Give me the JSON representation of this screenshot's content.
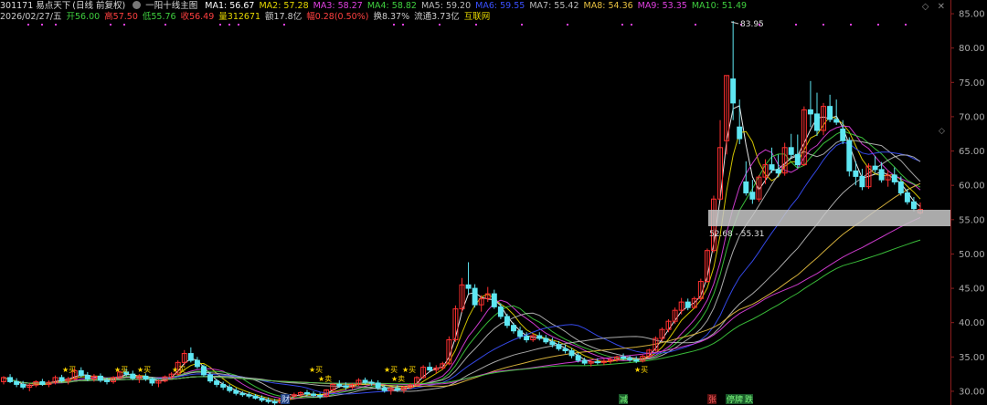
{
  "header": {
    "code": "301171",
    "name": "易点天下",
    "mode": "(日线 前复权)",
    "indicator": "一阳十线主图",
    "ma": [
      {
        "label": "MA1: 56.67",
        "color": "#ffffff"
      },
      {
        "label": "MA2: 57.28",
        "color": "#e5d700"
      },
      {
        "label": "MA3: 58.27",
        "color": "#e040e0"
      },
      {
        "label": "MA4: 58.82",
        "color": "#3fcf3f"
      },
      {
        "label": "MA5: 59.20",
        "color": "#bbbbbb"
      },
      {
        "label": "MA6: 59.55",
        "color": "#3a50ff"
      },
      {
        "label": "MA7: 55.42",
        "color": "#bbbbbb"
      },
      {
        "label": "MA8: 54.36",
        "color": "#e8c040"
      },
      {
        "label": "MA9: 53.35",
        "color": "#e040e0"
      },
      {
        "label": "MA10: 51.49",
        "color": "#3fcf3f"
      }
    ]
  },
  "info": [
    {
      "text": "2026/02/27/五",
      "color": "#cccccc"
    },
    {
      "text": "开56.00",
      "color": "#3fcf3f"
    },
    {
      "text": "高57.50",
      "color": "#ff4040"
    },
    {
      "text": "低55.76",
      "color": "#3fcf3f"
    },
    {
      "text": "收56.49",
      "color": "#ff4040"
    },
    {
      "text": "量312671",
      "color": "#e5d700"
    },
    {
      "text": "额17.8亿",
      "color": "#cccccc"
    },
    {
      "text": "幅0.28(0.50%)",
      "color": "#ff4040"
    },
    {
      "text": "换8.37%",
      "color": "#cccccc"
    },
    {
      "text": "流通3.73亿",
      "color": "#cccccc"
    },
    {
      "text": "互联网",
      "color": "#e5d700"
    }
  ],
  "axis": {
    "min": 28,
    "max": 87,
    "ticks": [
      "85.00",
      "80.00",
      "75.00",
      "70.00",
      "65.00",
      "60.00",
      "55.00",
      "50.00",
      "45.00",
      "40.00",
      "35.00",
      "30.00"
    ]
  },
  "annotations": {
    "high": "83.95",
    "low": "27.52",
    "zone": "52.68 - 55.31"
  },
  "markers": {
    "cai": "财",
    "jian": "减",
    "zhang": "张",
    "tingpai": "停牌",
    "die": "跌",
    "buy": "★买",
    "sell": "★卖"
  },
  "window": {
    "restore_icon": "◇",
    "close_icon": "✕"
  },
  "colors": {
    "up": "#ff3030",
    "down": "#5ee6f2",
    "background": "#000000",
    "axis": "#aaaaaa"
  },
  "chart_data": {
    "type": "candlestick",
    "ylim": [
      28,
      87
    ],
    "candles": [
      [
        31.4,
        32.2,
        31,
        32
      ],
      [
        32,
        32.5,
        31.2,
        31.4
      ],
      [
        31.4,
        31.9,
        30.6,
        31
      ],
      [
        31,
        31.5,
        30.3,
        30.6
      ],
      [
        30.6,
        31.2,
        30,
        30.9
      ],
      [
        30.9,
        31.6,
        30.6,
        31.4
      ],
      [
        31.4,
        31.8,
        30.8,
        31
      ],
      [
        31,
        31.6,
        30.6,
        31.3
      ],
      [
        31.3,
        32.3,
        31,
        32
      ],
      [
        32,
        32.4,
        31.3,
        31.5
      ],
      [
        31.5,
        32.1,
        31,
        31.8
      ],
      [
        31.8,
        33.4,
        31.6,
        33
      ],
      [
        33,
        33.5,
        32,
        32.3
      ],
      [
        32.3,
        32.8,
        31.5,
        31.8
      ],
      [
        31.8,
        32.5,
        31.4,
        32.2
      ],
      [
        32.2,
        32.6,
        31.3,
        31.6
      ],
      [
        31.6,
        32,
        31,
        31.4
      ],
      [
        31.4,
        32.2,
        31.1,
        32
      ],
      [
        32,
        33,
        31.8,
        32.8
      ],
      [
        32.8,
        33.3,
        32.2,
        32.5
      ],
      [
        32.5,
        33,
        31.6,
        31.9
      ],
      [
        31.9,
        32.5,
        31.2,
        32.2
      ],
      [
        32.2,
        32.6,
        31.5,
        31.8
      ],
      [
        31.8,
        32,
        30.8,
        31.2
      ],
      [
        31.2,
        31.7,
        30.6,
        31.5
      ],
      [
        31.5,
        32.3,
        31.3,
        32.1
      ],
      [
        32.1,
        32.8,
        31.8,
        32.5
      ],
      [
        32.5,
        34.5,
        32.3,
        34.2
      ],
      [
        34.2,
        36,
        33.8,
        35.5
      ],
      [
        35.5,
        36.4,
        34.2,
        34.5
      ],
      [
        34.5,
        35,
        33.3,
        33.6
      ],
      [
        33.6,
        33.9,
        32.1,
        32.4
      ],
      [
        32.4,
        32.8,
        31.2,
        31.5
      ],
      [
        31.5,
        31.8,
        30.6,
        31
      ],
      [
        31,
        31.4,
        30.2,
        30.6
      ],
      [
        30.6,
        31,
        29.8,
        30.1
      ],
      [
        30.1,
        30.5,
        29.4,
        29.7
      ],
      [
        29.7,
        30,
        29.2,
        29.5
      ],
      [
        29.5,
        29.9,
        29,
        29.3
      ],
      [
        29.3,
        29.6,
        28.8,
        29
      ],
      [
        29,
        29.4,
        28.4,
        28.7
      ],
      [
        28.7,
        29.1,
        28.2,
        28.5
      ],
      [
        28.5,
        28.9,
        27.5,
        28.3
      ],
      [
        28.3,
        29.2,
        28.1,
        28.9
      ],
      [
        28.9,
        29.6,
        28.6,
        29.3
      ],
      [
        29.3,
        29.8,
        29,
        29.5
      ],
      [
        29.5,
        30,
        29.2,
        29.8
      ],
      [
        29.8,
        30.2,
        29.3,
        29.6
      ],
      [
        29.6,
        30,
        29.1,
        29.4
      ],
      [
        29.4,
        29.8,
        28.9,
        29.3
      ],
      [
        29.3,
        30.3,
        29.1,
        30.2
      ],
      [
        30.2,
        31.2,
        30,
        31
      ],
      [
        31,
        31.6,
        30.5,
        30.8
      ],
      [
        30.8,
        31.3,
        30.2,
        30.6
      ],
      [
        30.6,
        31.2,
        30.3,
        31
      ],
      [
        31,
        31.9,
        30.8,
        31.6
      ],
      [
        31.6,
        32,
        31,
        31.3
      ],
      [
        31.3,
        31.7,
        30.8,
        31.2
      ],
      [
        31.2,
        31.6,
        30.2,
        30.5
      ],
      [
        30.5,
        30.9,
        29.8,
        30.1
      ],
      [
        30.1,
        30.6,
        29.5,
        30.4
      ],
      [
        30.4,
        30.9,
        29.9,
        30.2
      ],
      [
        30.2,
        30.8,
        29.7,
        30.6
      ],
      [
        30.6,
        31.2,
        30.3,
        30.9
      ],
      [
        30.9,
        32.2,
        30.7,
        32
      ],
      [
        32,
        33.8,
        31.8,
        33.5
      ],
      [
        33.5,
        34.2,
        32.8,
        33.1
      ],
      [
        33.1,
        33.8,
        32.6,
        33.4
      ],
      [
        33.4,
        34.3,
        33.1,
        34
      ],
      [
        34,
        38,
        33.8,
        37.5
      ],
      [
        37.5,
        42.5,
        37.2,
        42
      ],
      [
        42,
        46.5,
        41.5,
        45.5
      ],
      [
        45.5,
        48.8,
        44.2,
        45
      ],
      [
        45,
        45.6,
        42.2,
        42.6
      ],
      [
        42.6,
        44,
        41.6,
        43.5
      ],
      [
        43.5,
        45.2,
        43,
        44.2
      ],
      [
        44.2,
        44.8,
        42,
        42.3
      ],
      [
        42.3,
        42.8,
        40.5,
        40.9
      ],
      [
        40.9,
        41.3,
        39.2,
        39.6
      ],
      [
        39.6,
        40,
        38.4,
        38.8
      ],
      [
        38.8,
        39.4,
        37.6,
        38
      ],
      [
        38,
        38.6,
        37.1,
        37.5
      ],
      [
        37.5,
        38.4,
        37.2,
        38.1
      ],
      [
        38.1,
        38.6,
        37.4,
        37.7
      ],
      [
        37.7,
        38.2,
        36.9,
        37.2
      ],
      [
        37.2,
        37.8,
        36.4,
        36.8
      ],
      [
        36.8,
        37.3,
        35.9,
        36.2
      ],
      [
        36.2,
        36.8,
        35.5,
        35.9
      ],
      [
        35.9,
        36.3,
        34.8,
        35.2
      ],
      [
        35.2,
        35.6,
        34.2,
        34.5
      ],
      [
        34.5,
        34.9,
        33.8,
        34.1
      ],
      [
        34.1,
        34.6,
        33.6,
        34.3
      ],
      [
        34.3,
        34.8,
        33.9,
        34.2
      ],
      [
        34.2,
        34.7,
        33.8,
        34.4
      ],
      [
        34.4,
        34.9,
        34,
        34.6
      ],
      [
        34.6,
        35.2,
        34.3,
        35
      ],
      [
        35,
        35.5,
        34.5,
        34.8
      ],
      [
        34.8,
        35.2,
        34.3,
        34.6
      ],
      [
        34.6,
        35.1,
        34.1,
        34.4
      ],
      [
        34.4,
        35.3,
        34.2,
        35.1
      ],
      [
        35.1,
        36.2,
        34.9,
        36
      ],
      [
        36,
        38,
        35.8,
        37.7
      ],
      [
        37.7,
        39.3,
        37.3,
        39
      ],
      [
        39,
        40.5,
        38.6,
        40.2
      ],
      [
        40.2,
        42.2,
        39.8,
        41.8
      ],
      [
        41.8,
        43.6,
        41.2,
        43
      ],
      [
        43,
        43.5,
        41.8,
        42.2
      ],
      [
        42.2,
        43.8,
        42,
        43.5
      ],
      [
        43.5,
        46.4,
        43.2,
        46
      ],
      [
        46,
        50.8,
        45.8,
        50.5
      ],
      [
        50.5,
        58.5,
        50.2,
        58
      ],
      [
        58,
        69.5,
        58,
        65.5
      ],
      [
        66.5,
        76,
        64.5,
        76
      ],
      [
        75.5,
        83.95,
        69.5,
        72
      ],
      [
        68.5,
        72.5,
        66,
        66.8
      ],
      [
        60.5,
        63.5,
        58.5,
        58.9
      ],
      [
        59,
        60.8,
        57.3,
        58
      ],
      [
        58,
        61.5,
        57.6,
        61.2
      ],
      [
        61.2,
        63.8,
        60.2,
        63
      ],
      [
        63,
        65.5,
        61.8,
        62.3
      ],
      [
        62.3,
        64.5,
        61.2,
        61.8
      ],
      [
        61.8,
        66.2,
        61.4,
        65.5
      ],
      [
        65.5,
        67.5,
        64,
        64.5
      ],
      [
        64.5,
        67.4,
        62.5,
        63
      ],
      [
        63,
        71.5,
        62.8,
        71
      ],
      [
        71,
        75.2,
        68.5,
        70.4
      ],
      [
        70.4,
        73.5,
        67.2,
        68
      ],
      [
        68,
        72,
        67.3,
        71.5
      ],
      [
        71.5,
        73.2,
        69.2,
        69.6
      ],
      [
        69.6,
        72.5,
        68.8,
        69.2
      ],
      [
        68.2,
        69.5,
        66,
        66.5
      ],
      [
        66.5,
        67,
        61.3,
        62.1
      ],
      [
        62.1,
        63.5,
        60,
        61.3
      ],
      [
        61.3,
        62.4,
        59.3,
        59.8
      ],
      [
        59.8,
        63.2,
        59.5,
        62.8
      ],
      [
        62.8,
        64.3,
        61.8,
        62.3
      ],
      [
        62.3,
        63.4,
        60.4,
        60.8
      ],
      [
        60.8,
        62.2,
        59.8,
        61.5
      ],
      [
        61.5,
        62.6,
        60.1,
        60.5
      ],
      [
        60.5,
        61.3,
        58.5,
        58.9
      ],
      [
        58.9,
        59.5,
        57.2,
        57.6
      ],
      [
        57.6,
        58.3,
        56.2,
        56.6
      ],
      [
        56,
        57.5,
        55.76,
        56.49
      ]
    ]
  }
}
